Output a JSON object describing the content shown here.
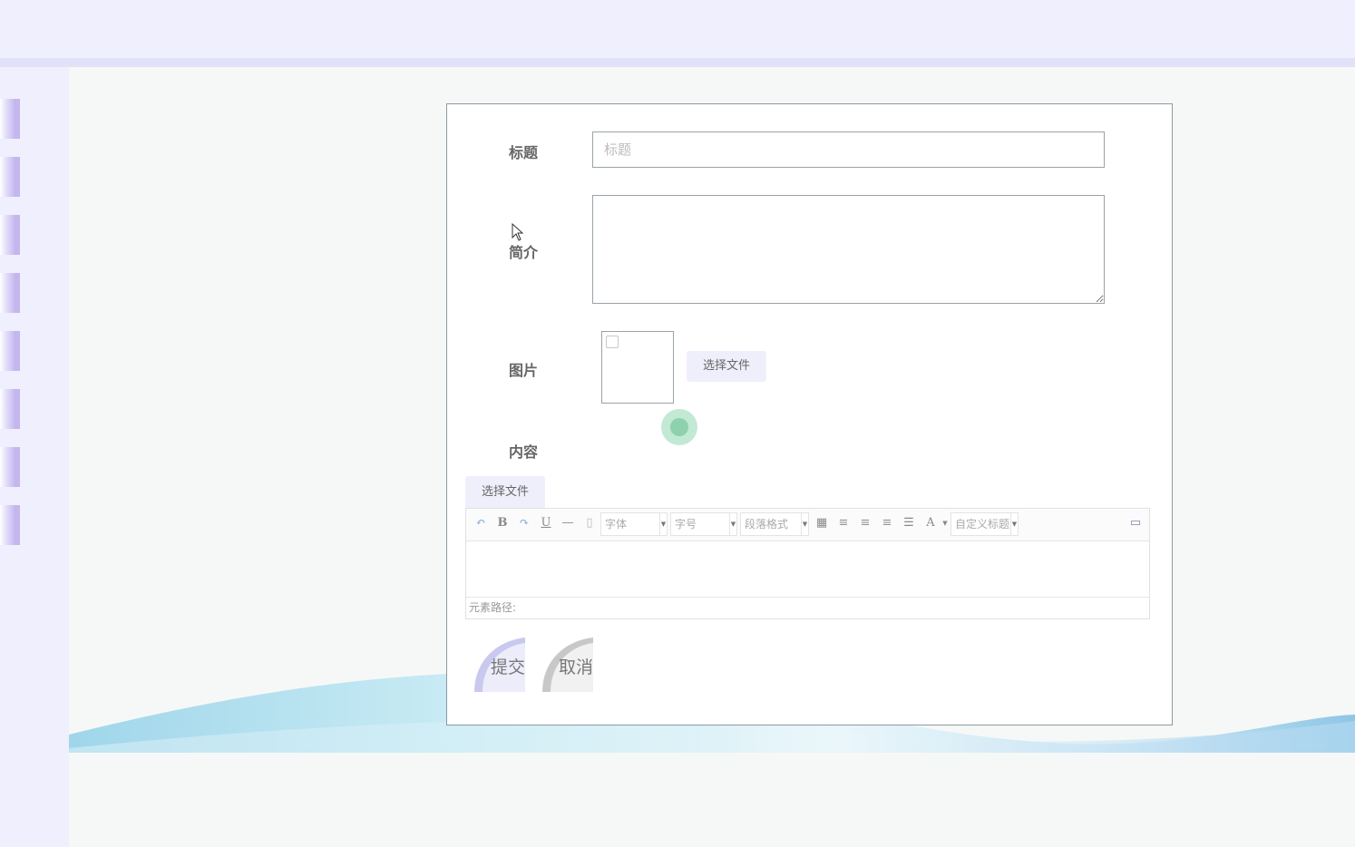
{
  "form": {
    "title_label": "标题",
    "title_placeholder": "标题",
    "intro_label": "简介",
    "image_label": "图片",
    "image_button": "选择文件",
    "content_label": "内容",
    "content_button": "选择文件"
  },
  "editor": {
    "font_select": "字体",
    "size_select": "字号",
    "paragraph_select": "段落格式",
    "custom_title_select": "自定义标题",
    "status_path": "元素路径:"
  },
  "actions": {
    "submit": "提交",
    "cancel": "取消"
  },
  "colors": {
    "topbar": "#efeffe",
    "sidebar_button": "#c5b6ee",
    "button_bg": "#efeffc",
    "click_indicator": "#78cea0"
  }
}
